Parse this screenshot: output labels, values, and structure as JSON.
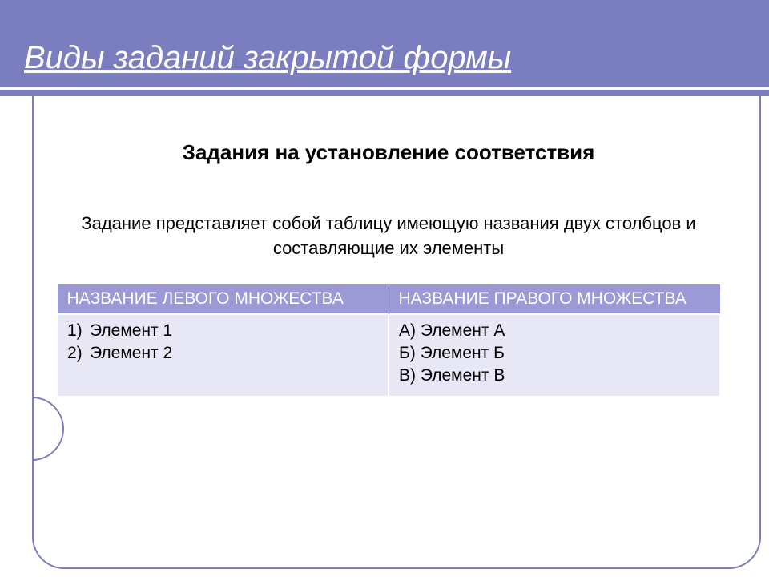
{
  "header": {
    "title": "Виды заданий закрытой формы"
  },
  "content": {
    "subtitle": "Задания на установление соответствия",
    "description": "Задание представляет собой таблицу имеющую названия двух столбцов и составляющие их элементы"
  },
  "table": {
    "headers": {
      "left": "НАЗВАНИЕ ЛЕВОГО МНОЖЕСТВА",
      "right": "НАЗВАНИЕ ПРАВОГО МНОЖЕСТВА"
    },
    "left_items": {
      "item1_marker": "1)",
      "item1_text": "Элемент 1",
      "item2_marker": "2)",
      "item2_text": "Элемент 2"
    },
    "right_items": {
      "item1": "А) Элемент А",
      "item2": "Б) Элемент Б",
      "item3": "В) Элемент В"
    }
  }
}
